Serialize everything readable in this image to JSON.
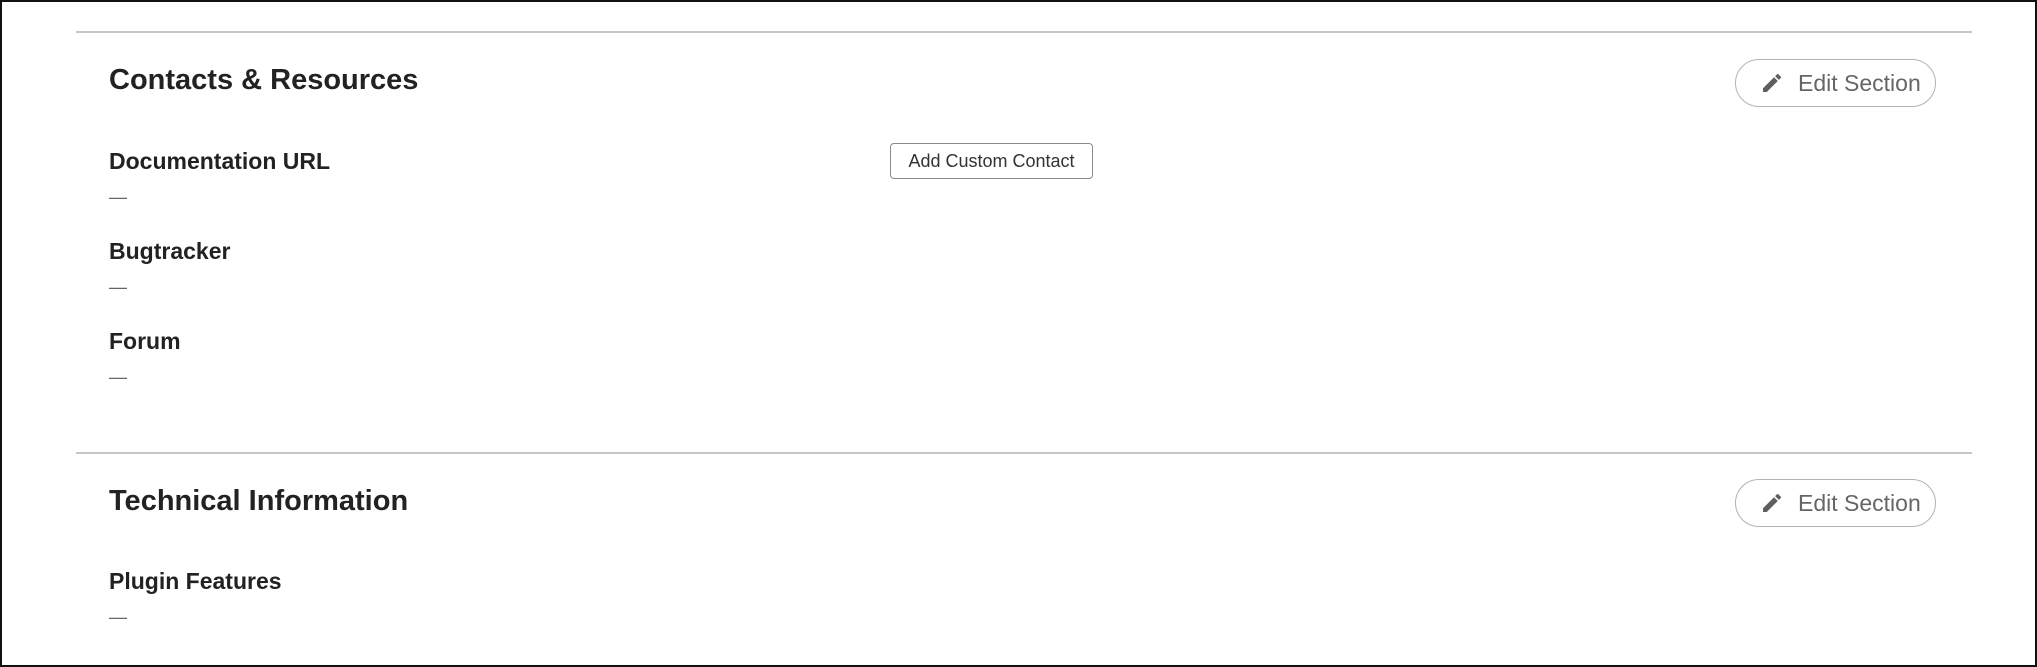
{
  "sections": [
    {
      "title": "Contacts & Resources",
      "edit_label": "Edit Section",
      "edit_icon": "pencil-icon",
      "add_contact_label": "Add Custom Contact",
      "fields": [
        {
          "label": "Documentation URL",
          "value": "—"
        },
        {
          "label": "Bugtracker",
          "value": "—"
        },
        {
          "label": "Forum",
          "value": "—"
        }
      ]
    },
    {
      "title": "Technical Information",
      "edit_label": "Edit Section",
      "edit_icon": "pencil-icon",
      "fields": [
        {
          "label": "Plugin Features",
          "value": "—"
        }
      ]
    }
  ],
  "colors": {
    "text": "#222222",
    "muted": "#666666",
    "divider": "#c6c6c6",
    "button_border": "#b3b3b3"
  }
}
